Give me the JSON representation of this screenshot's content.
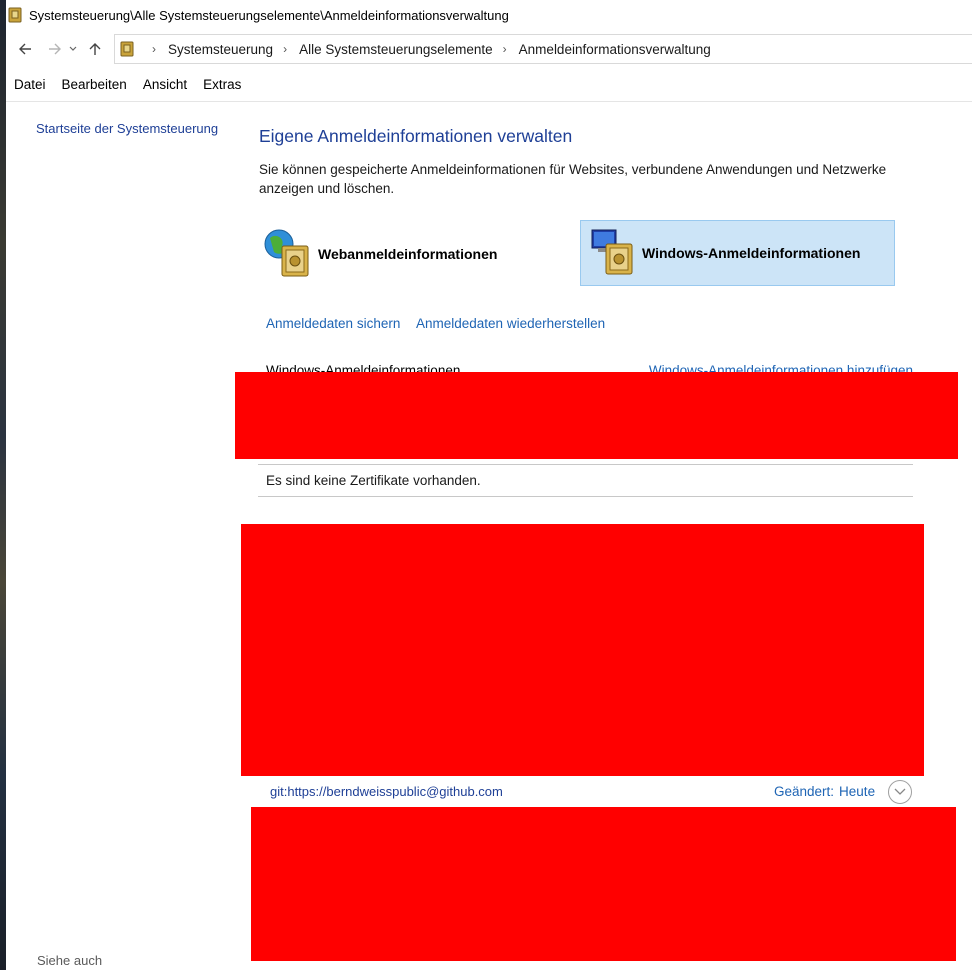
{
  "window": {
    "title": "Systemsteuerung\\Alle Systemsteuerungselemente\\Anmeldeinformationsverwaltung"
  },
  "address": {
    "crumbs": [
      "Systemsteuerung",
      "Alle Systemsteuerungselemente",
      "Anmeldeinformationsverwaltung"
    ]
  },
  "menu": {
    "items": [
      "Datei",
      "Bearbeiten",
      "Ansicht",
      "Extras"
    ]
  },
  "sidebar": {
    "home_link": "Startseite der Systemsteuerung",
    "see_also": "Siehe auch"
  },
  "main": {
    "heading": "Eigene Anmeldeinformationen verwalten",
    "description": "Sie können gespeicherte Anmeldeinformationen für Websites, verbundene Anwendungen und Netzwerke anzeigen und löschen.",
    "web_credentials_label": "Webanmeldeinformationen",
    "windows_credentials_label": "Windows-Anmeldeinformationen",
    "backup_link": "Anmeldedaten sichern",
    "restore_link": "Anmeldedaten wiederherstellen",
    "section_title": "Windows-Anmeldeinformationen",
    "add_link": "Windows-Anmeldeinformationen hinzufügen",
    "no_certificates": "Es sind keine Zertifikate vorhanden.",
    "git_entry": {
      "name": "git:https://berndweisspublic@github.com",
      "changed_label": "Geändert:",
      "changed_value": "Heute"
    }
  },
  "colors": {
    "link": "#1e64b4",
    "heading": "#1e3f96",
    "selected_bg": "#cce4f7",
    "redaction": "#ff0000"
  },
  "icons": [
    "control-panel-icon",
    "back-arrow-icon",
    "forward-arrow-icon",
    "recent-chevron-icon",
    "up-arrow-icon",
    "globe-vault-icon",
    "computer-vault-icon",
    "expand-chevron-icon"
  ]
}
